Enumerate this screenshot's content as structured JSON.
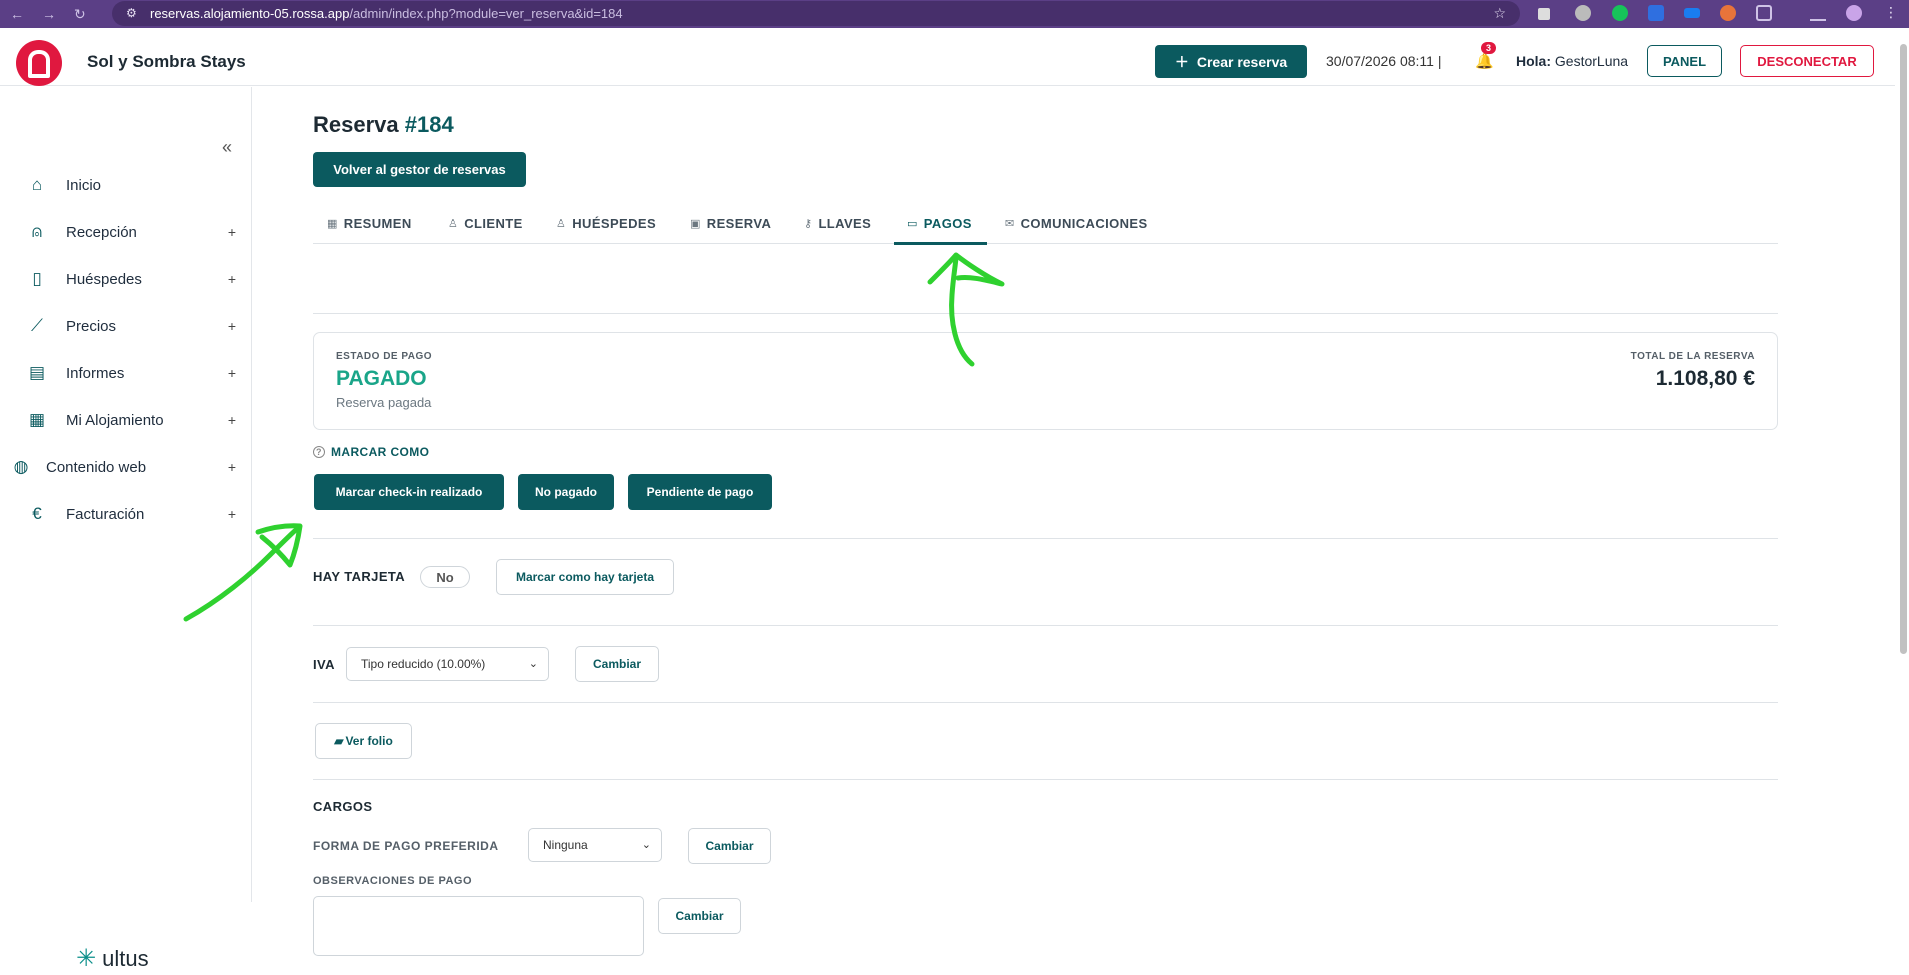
{
  "browser": {
    "url_host": "reservas.alojamiento-05.rossa.app",
    "url_path": "/admin/index.php?module=ver_reserva&id=184"
  },
  "header": {
    "brand": "Sol y Sombra Stays",
    "create_button": "Crear reserva",
    "datetime": "30/07/2026 08:11 |",
    "notifications_count": "3",
    "greeting": "Hola:",
    "username": "GestorLuna",
    "panel_button": "PANEL",
    "logout_button": "DESCONECTAR"
  },
  "sidebar": {
    "items": [
      {
        "label": "Inicio",
        "icon": "home-icon",
        "expandable": false
      },
      {
        "label": "Recepción",
        "icon": "reception-bell-icon",
        "expandable": true
      },
      {
        "label": "Huéspedes",
        "icon": "luggage-icon",
        "expandable": true
      },
      {
        "label": "Precios",
        "icon": "chart-line-icon",
        "expandable": true
      },
      {
        "label": "Informes",
        "icon": "scroll-icon",
        "expandable": true
      },
      {
        "label": "Mi Alojamiento",
        "icon": "building-icon",
        "expandable": true
      },
      {
        "label": "Contenido web",
        "icon": "globe-icon",
        "expandable": true
      },
      {
        "label": "Facturación",
        "icon": "euro-icon",
        "expandable": true
      }
    ],
    "footer_brand": "ultus"
  },
  "page": {
    "title_prefix": "Reserva",
    "title_number": "#184",
    "back_button": "Volver al gestor de reservas"
  },
  "tabs": [
    {
      "label": "RESUMEN",
      "icon": "grid-icon",
      "active": false
    },
    {
      "label": "CLIENTE",
      "icon": "user-icon",
      "active": false
    },
    {
      "label": "HUÉSPEDES",
      "icon": "users-icon",
      "active": false
    },
    {
      "label": "RESERVA",
      "icon": "calendar-icon",
      "active": false
    },
    {
      "label": "LLAVES",
      "icon": "key-icon",
      "active": false
    },
    {
      "label": "PAGOS",
      "icon": "card-icon",
      "active": true
    },
    {
      "label": "COMUNICACIONES",
      "icon": "mail-icon",
      "active": false
    }
  ],
  "payment": {
    "status_label": "ESTADO DE PAGO",
    "status_value": "PAGADO",
    "status_desc": "Reserva pagada",
    "total_label": "TOTAL DE LA RESERVA",
    "total_value": "1.108,80 €",
    "mark_as_label": "MARCAR COMO",
    "actions": [
      "Marcar check-in realizado",
      "No pagado",
      "Pendiente de pago"
    ]
  },
  "card": {
    "label": "HAY TARJETA",
    "value": "No",
    "button": "Marcar como hay tarjeta"
  },
  "iva": {
    "label": "IVA",
    "selected": "Tipo reducido (10.00%)",
    "button": "Cambiar"
  },
  "folio": {
    "button": "Ver folio"
  },
  "cargos": {
    "title": "CARGOS",
    "payment_method_label": "FORMA DE PAGO PREFERIDA",
    "payment_method_selected": "Ninguna",
    "payment_method_button": "Cambiar",
    "notes_label": "OBSERVACIONES DE PAGO",
    "notes_button": "Cambiar"
  },
  "colors": {
    "primary": "#0b5a5f",
    "danger": "#e0183f",
    "paid": "#1aa589",
    "annotation": "#2fd12f",
    "browser": "#5b3f86"
  }
}
